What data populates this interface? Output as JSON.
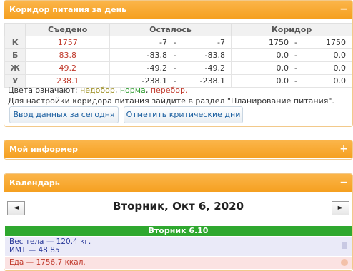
{
  "corridor": {
    "title": "Коридор питания за день",
    "toggle": "−",
    "headers": {
      "eaten": "Съедено",
      "remaining": "Осталось",
      "corridor": "Коридор"
    },
    "rows": [
      {
        "label": "К",
        "eaten": "1757",
        "rem_a": "-7",
        "rem_sep": "-",
        "rem_b": "-7",
        "cor_a": "1750",
        "cor_sep": "-",
        "cor_b": "1750"
      },
      {
        "label": "Б",
        "eaten": "83.8",
        "rem_a": "-83.8",
        "rem_sep": "-",
        "rem_b": "-83.8",
        "cor_a": "0.0",
        "cor_sep": "-",
        "cor_b": "0.0"
      },
      {
        "label": "Ж",
        "eaten": "49.2",
        "rem_a": "-49.2",
        "rem_sep": "-",
        "rem_b": "-49.2",
        "cor_a": "0.0",
        "cor_sep": "-",
        "cor_b": "0.0"
      },
      {
        "label": "У",
        "eaten": "238.1",
        "rem_a": "-238.1",
        "rem_sep": "-",
        "rem_b": "-238.1",
        "cor_a": "0.0",
        "cor_sep": "-",
        "cor_b": "0.0"
      }
    ],
    "legend_prefix": "Цвета означают:",
    "legend_under": "недобор",
    "legend_norm": "норма",
    "legend_over": "перебор.",
    "hint": "Для настройки коридора питания зайдите в раздел \"Планирование питания\".",
    "btn_today": "Ввод данных за сегодня",
    "btn_critical": "Отметить критические дни"
  },
  "informer": {
    "title": "Мой информер",
    "toggle": "+"
  },
  "calendar": {
    "title": "Календарь",
    "toggle": "−",
    "prev": "◄",
    "next": "►",
    "date": "Вторник, Окт 6, 2020",
    "day_label": "Вторник 6.10",
    "weight_line": "Вес тела — 120.4 кг.",
    "bmi_line": "ИМТ — 48.85",
    "food_line": "Еда — 1756.7 ккал."
  },
  "colors": {
    "accent": "#f5a020",
    "eaten": "#c0392b",
    "norm": "#2b9a2b",
    "under": "#9a8b1c",
    "daybar": "#2fa82f"
  }
}
